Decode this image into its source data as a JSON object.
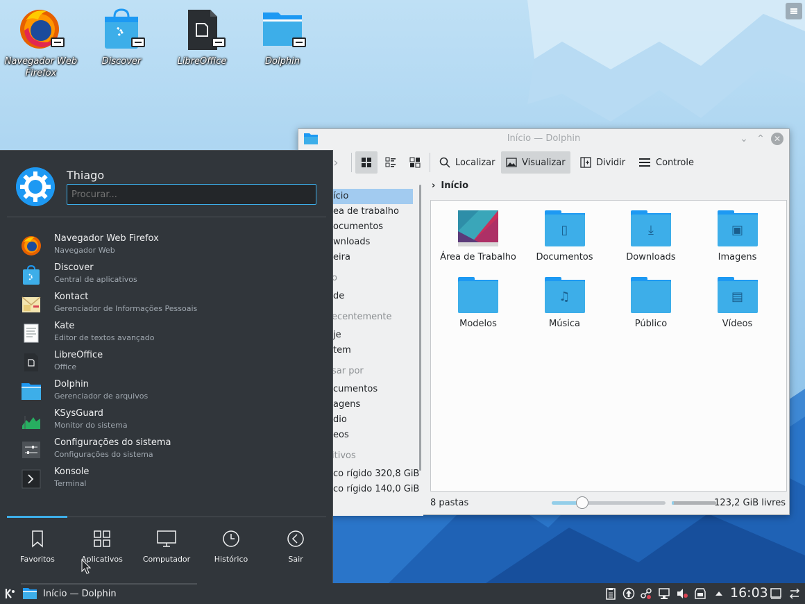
{
  "desktop": {
    "icons": [
      {
        "label": "Navegador Web Firefox",
        "icon": "firefox-icon"
      },
      {
        "label": "Discover",
        "icon": "discover-icon"
      },
      {
        "label": "LibreOffice",
        "icon": "libreoffice-icon"
      },
      {
        "label": "Dolphin",
        "icon": "dolphin-folder-icon"
      }
    ]
  },
  "dolphin": {
    "title": "Início — Dolphin",
    "toolbar": {
      "find_label": "Localizar",
      "preview_label": "Visualizar",
      "split_label": "Dividir",
      "control_label": "Controle"
    },
    "breadcrumb": "Início",
    "places": [
      {
        "label": "ício",
        "type": "item",
        "selected": true
      },
      {
        "label": "ea de trabalho",
        "type": "item"
      },
      {
        "label": "ocumentos",
        "type": "item"
      },
      {
        "label": "wnloads",
        "type": "item"
      },
      {
        "label": "eira",
        "type": "item"
      },
      {
        "label": "o",
        "type": "header"
      },
      {
        "label": "de",
        "type": "item"
      },
      {
        "label": "ecentemente",
        "type": "header"
      },
      {
        "label": "je",
        "type": "item"
      },
      {
        "label": "tem",
        "type": "item"
      },
      {
        "label": "sar por",
        "type": "header"
      },
      {
        "label": "cumentos",
        "type": "item"
      },
      {
        "label": "agens",
        "type": "item"
      },
      {
        "label": "dio",
        "type": "item"
      },
      {
        "label": "eos",
        "type": "item"
      },
      {
        "label": "itivos",
        "type": "header"
      },
      {
        "label": "co rígido 320,8 GiB",
        "type": "item"
      },
      {
        "label": "co rígido 140,0 GiB",
        "type": "item"
      }
    ],
    "folders": [
      {
        "label": "Área de Trabalho",
        "icon": "desktop-folder-icon"
      },
      {
        "label": "Documentos",
        "icon": "documents-folder-icon"
      },
      {
        "label": "Downloads",
        "icon": "downloads-folder-icon"
      },
      {
        "label": "Imagens",
        "icon": "pictures-folder-icon"
      },
      {
        "label": "Modelos",
        "icon": "templates-folder-icon"
      },
      {
        "label": "Música",
        "icon": "music-folder-icon"
      },
      {
        "label": "Público",
        "icon": "public-folder-icon"
      },
      {
        "label": "Vídeos",
        "icon": "videos-folder-icon"
      }
    ],
    "status": {
      "items_count": "8 pastas",
      "free_space": "123,2 GiB livres",
      "zoom_level": 0.27,
      "disk_used_fraction": 0.05
    }
  },
  "kickoff": {
    "user_name": "Thiago",
    "search_placeholder": "Procurar...",
    "apps": [
      {
        "name": "Navegador Web Firefox",
        "description": "Navegador Web",
        "icon": "firefox-icon"
      },
      {
        "name": "Discover",
        "description": "Central de aplicativos",
        "icon": "discover-icon"
      },
      {
        "name": "Kontact",
        "description": "Gerenciador de Informações Pessoais",
        "icon": "kontact-icon"
      },
      {
        "name": "Kate",
        "description": "Editor de textos avançado",
        "icon": "kate-icon"
      },
      {
        "name": "LibreOffice",
        "description": "Office",
        "icon": "libreoffice-icon"
      },
      {
        "name": "Dolphin",
        "description": "Gerenciador de arquivos",
        "icon": "dolphin-folder-icon"
      },
      {
        "name": "KSysGuard",
        "description": "Monitor do sistema",
        "icon": "ksysguard-icon"
      },
      {
        "name": "Configurações do sistema",
        "description": "Configurações do sistema",
        "icon": "system-settings-icon"
      },
      {
        "name": "Konsole",
        "description": "Terminal",
        "icon": "konsole-icon"
      }
    ],
    "tabs": [
      {
        "label": "Favoritos",
        "icon": "bookmark-icon",
        "active": true
      },
      {
        "label": "Aplicativos",
        "icon": "apps-grid-icon"
      },
      {
        "label": "Computador",
        "icon": "computer-icon"
      },
      {
        "label": "Histórico",
        "icon": "clock-icon"
      },
      {
        "label": "Sair",
        "icon": "leave-icon"
      }
    ]
  },
  "panel": {
    "task_label": "Início — Dolphin",
    "clock": "16:03"
  },
  "colors": {
    "accent": "#3daee9",
    "folder": "#3daee9",
    "panel_bg": "#31363b",
    "window_bg": "#eff0f1"
  }
}
